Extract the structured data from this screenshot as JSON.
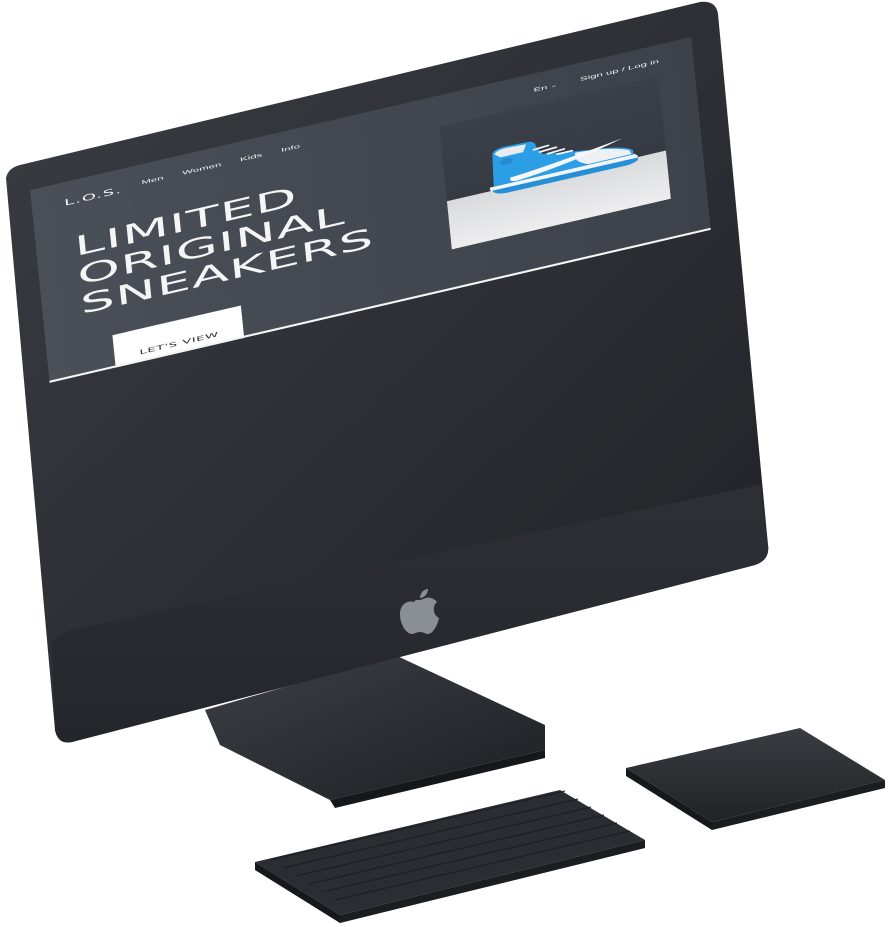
{
  "site": {
    "logo": "L.O.S.",
    "nav": [
      "Men",
      "Women",
      "Kids",
      "Info"
    ],
    "language": "En",
    "auth": "Sign up / Log in",
    "headline": [
      "LIMITED",
      "ORIGINAL",
      "SNEAKERS"
    ],
    "cta": "LET'S VIEW"
  },
  "icons": {
    "language_chevron": "chevron-down-icon",
    "brand": "apple-logo",
    "product": "sneaker"
  },
  "colors": {
    "screen_bg": "#474b53",
    "text": "#f5f5f5",
    "cta_bg": "#ffffff",
    "shoe_blue": "#2b9ee6",
    "device_dark": "#2a2c31"
  }
}
